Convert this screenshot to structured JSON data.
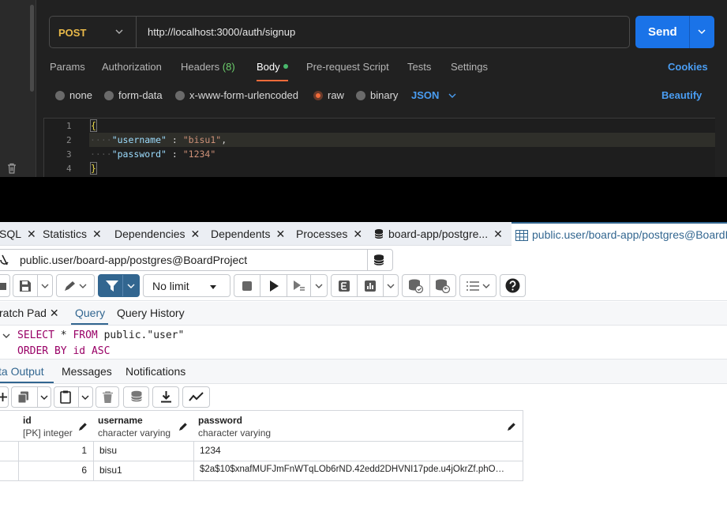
{
  "postman": {
    "method": "POST",
    "url": "http://localhost:3000/auth/signup",
    "send_label": "Send",
    "tabs": {
      "params": "Params",
      "authorization": "Authorization",
      "headers": "Headers",
      "headers_count": "(8)",
      "body": "Body",
      "prerequest": "Pre-request Script",
      "tests": "Tests",
      "settings": "Settings"
    },
    "cookies": "Cookies",
    "body_types": {
      "none": "none",
      "form_data": "form-data",
      "urlencoded": "x-www-form-urlencoded",
      "raw": "raw",
      "binary": "binary"
    },
    "raw_format": "JSON",
    "beautify": "Beautify",
    "editor": {
      "line_numbers": [
        "1",
        "2",
        "3",
        "4"
      ],
      "open_brace": "{",
      "close_brace": "}",
      "key1": "\"username\"",
      "val1": "\"bisu1\"",
      "key2": "\"password\"",
      "val2": "\"1234\""
    }
  },
  "pgadmin": {
    "tabs": {
      "sql": "SQL",
      "statistics": "Statistics",
      "dependencies": "Dependencies",
      "dependents": "Dependents",
      "processes": "Processes",
      "board_app": "board-app/postgre...",
      "active": "public.user/board-app/postgres@BoardProject"
    },
    "connection": "public.user/board-app/postgres@BoardProject",
    "limit": "No limit",
    "query_tabs": {
      "scratch": "ratch Pad",
      "query": "Query",
      "history": "Query History"
    },
    "sql": {
      "line1_kw1": "SELECT",
      "line1_rest": " * ",
      "line1_kw2": "FROM",
      "line1_obj": " public.\"user\"",
      "line2_kw": "ORDER BY",
      "line2_id": " id ",
      "line2_asc": "ASC"
    },
    "output_tabs": {
      "data": "ta Output",
      "messages": "Messages",
      "notifications": "Notifications"
    },
    "grid": {
      "columns": [
        {
          "name": "id",
          "type": "[PK] integer"
        },
        {
          "name": "username",
          "type": "character varying"
        },
        {
          "name": "password",
          "type": "character varying"
        }
      ],
      "rows": [
        {
          "id": "1",
          "username": "bisu",
          "password": "1234"
        },
        {
          "id": "6",
          "username": "bisu1",
          "password": "$2a$10$xnafMUFJmFnWTqLOb6rND.42edd2DHVNI17pde.u4jOkrZf.phO…"
        }
      ]
    }
  }
}
